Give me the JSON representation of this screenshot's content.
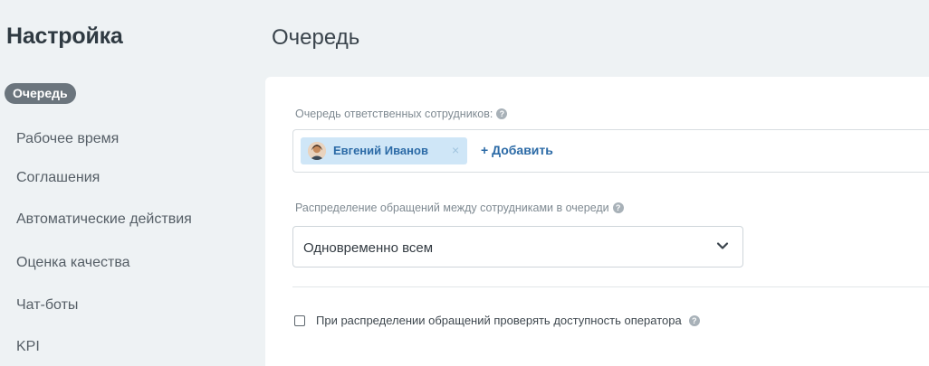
{
  "sidebar": {
    "title": "Настройка",
    "items": [
      {
        "label": "Очередь",
        "active": true
      },
      {
        "label": "Рабочее время"
      },
      {
        "label": "Соглашения"
      },
      {
        "label": "Автоматические действия"
      },
      {
        "label": "Оценка качества"
      },
      {
        "label": "Чат-боты"
      },
      {
        "label": "KPI"
      }
    ]
  },
  "main": {
    "title": "Очередь",
    "queue": {
      "label": "Очередь ответственных сотрудников:",
      "help_icon": "?",
      "members": [
        {
          "name": "Евгений Иванов",
          "remove_icon": "×"
        }
      ],
      "add_label": "+ Добавить"
    },
    "distribution": {
      "label": "Распределение обращений между сотрудниками в очереди",
      "help_icon": "?",
      "selected": "Одновременно всем"
    },
    "availability": {
      "label": "При распределении обращений проверять доступность оператора",
      "checked": false,
      "help_icon": "?"
    }
  },
  "colors": {
    "background": "#eef2f4",
    "accent": "#2b6aa6",
    "chip_bg": "#cfe6f7",
    "active_nav_bg": "#6b757d"
  }
}
